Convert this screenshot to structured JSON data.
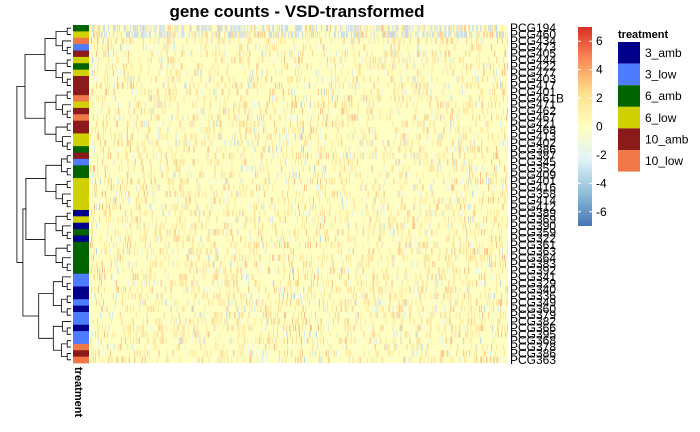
{
  "chart_data": {
    "type": "heatmap",
    "title": "gene counts - VSD-transformed",
    "annotation_label": "treatment",
    "row_labels": [
      "PCG194",
      "PCG460",
      "PCG434",
      "PCG473",
      "PCG405",
      "PCG444",
      "PCG422",
      "PCG477",
      "PCG403",
      "PCG417",
      "PCG401",
      "PCG461B",
      "PCG471",
      "PCG462",
      "PCG467",
      "PCG421",
      "PCG468",
      "PCG413",
      "PCG402",
      "PCG386",
      "PCG387",
      "PCG345",
      "PCG352",
      "PCG409",
      "PCG401",
      "PCG416",
      "PCG358",
      "PCG414",
      "PCG412",
      "PCG389",
      "PCG369",
      "PCG390",
      "PCG359",
      "PCG322",
      "PCG361",
      "PCG363",
      "PCG364",
      "PCG383",
      "PCG392",
      "PCG341",
      "PCG329",
      "PCG340",
      "PCG336",
      "PCG349",
      "PCG360",
      "PCG379",
      "PCG382",
      "PCG366",
      "PCG395",
      "PCG368",
      "PCG378",
      "PCG386",
      "PCG363"
    ],
    "treatment_per_row": [
      "6_amb",
      "6_low",
      "10_low",
      "3_low",
      "10_amb",
      "6_low",
      "6_amb",
      "6_low",
      "10_amb",
      "10_amb",
      "10_amb",
      "10_low",
      "6_low",
      "10_amb",
      "10_low",
      "10_amb",
      "10_amb",
      "6_low",
      "6_low",
      "6_amb",
      "10_amb",
      "3_low",
      "6_amb",
      "6_amb",
      "6_low",
      "6_low",
      "6_low",
      "6_low",
      "6_low",
      "3_amb",
      "6_low",
      "3_amb",
      "6_amb",
      "3_amb",
      "6_amb",
      "6_amb",
      "6_amb",
      "6_amb",
      "6_amb",
      "3_low",
      "3_low",
      "3_amb",
      "3_amb",
      "3_low",
      "3_amb",
      "3_low",
      "3_low",
      "3_amb",
      "3_low",
      "3_low",
      "10_low",
      "10_amb",
      "10_low"
    ],
    "colorbar": {
      "ticks": [
        6,
        4,
        2,
        0,
        -2,
        -4,
        -6
      ],
      "range": [
        -7,
        7
      ]
    },
    "legend": {
      "title": "treatment",
      "items": [
        {
          "label": "3_amb",
          "color": "#00008b"
        },
        {
          "label": "3_low",
          "color": "#4f7cff"
        },
        {
          "label": "6_amb",
          "color": "#006400"
        },
        {
          "label": "6_low",
          "color": "#cfd200"
        },
        {
          "label": "10_amb",
          "color": "#8b1a1a"
        },
        {
          "label": "10_low",
          "color": "#f07848"
        }
      ]
    },
    "scale_colors": [
      "#4575b4",
      "#91bfdb",
      "#e0f3f8",
      "#ffffbf",
      "#fee090",
      "#fc8d59",
      "#d73027"
    ],
    "n_columns": 420,
    "value_distribution": "mostly near 0 (pale yellow), sparse moderate positives (orange) and negatives (light blue)"
  }
}
